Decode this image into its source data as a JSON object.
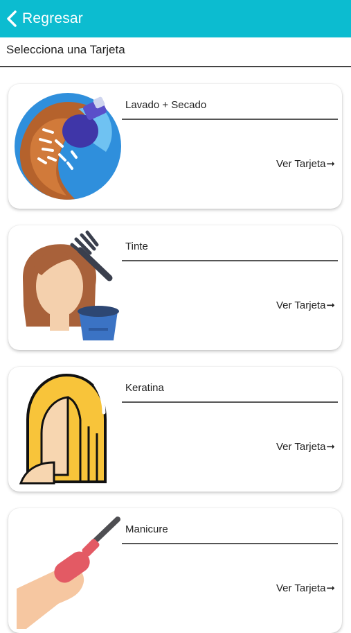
{
  "header": {
    "back_label": "Regresar",
    "icon": "chevron-left-icon",
    "bar_color": "#0cbcd0"
  },
  "page": {
    "subtitle": "Selecciona una Tarjeta"
  },
  "cards": [
    {
      "title": "Lavado + Secado",
      "cta": "Ver Tarjeta",
      "icon": "shower-head-hair-icon"
    },
    {
      "title": "Tinte",
      "cta": "Ver Tarjeta",
      "icon": "hair-dye-brush-icon"
    },
    {
      "title": "Keratina",
      "cta": "Ver Tarjeta",
      "icon": "long-blonde-hair-icon"
    },
    {
      "title": "Manicure",
      "cta": "Ver Tarjeta",
      "icon": "nail-polish-icon"
    }
  ],
  "cta_arrow": "➞"
}
